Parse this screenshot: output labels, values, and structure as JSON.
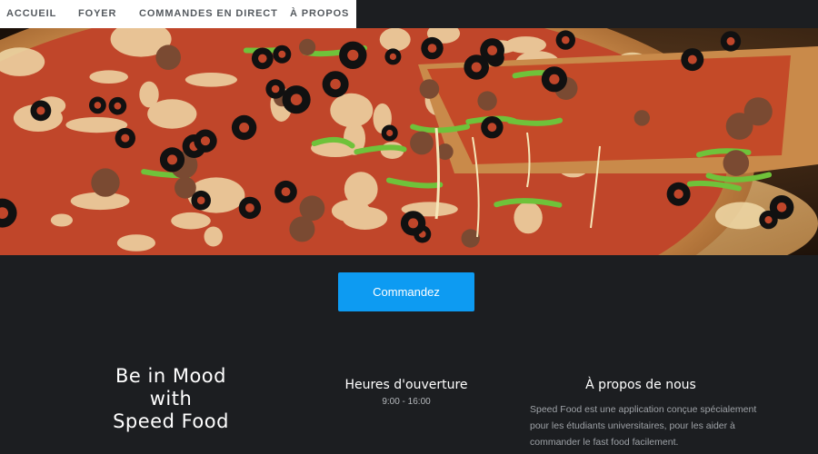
{
  "nav": {
    "items": [
      {
        "label": "ACCUEIL"
      },
      {
        "label": "FOYER"
      },
      {
        "label": "COMMANDES EN DIRECT"
      },
      {
        "label": "À PROPOS"
      }
    ]
  },
  "hero": {
    "image": "pizza-photo"
  },
  "cta": {
    "label": "Commandez",
    "color": "#0d9bf2"
  },
  "tagline": {
    "line1": "Be in Mood",
    "line2": "with",
    "line3": "Speed Food"
  },
  "hours": {
    "title": "Heures d'ouverture",
    "value": "9:00 - 16:00"
  },
  "about": {
    "title": "À propos de nous",
    "text": "Speed Food est une application conçue spécialement pour les étudiants universitaires, pour les aider à commander le fast food facilement."
  },
  "colors": {
    "background": "#1c1e21",
    "nav_background": "#ffffff",
    "nav_text": "#555a5f"
  }
}
